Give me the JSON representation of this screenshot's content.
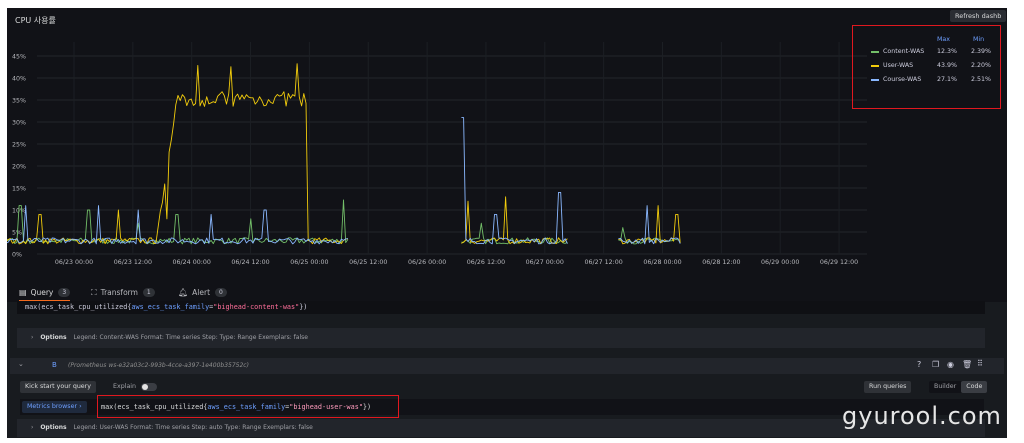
{
  "panel": {
    "title": "CPU 사용률",
    "refresh_label": "Refresh dashb"
  },
  "chart_data": {
    "type": "line",
    "title": "CPU 사용률",
    "ylim": [
      0,
      48
    ],
    "y_ticks": [
      "0%",
      "5%",
      "10%",
      "15%",
      "20%",
      "25%",
      "30%",
      "35%",
      "40%",
      "45%"
    ],
    "x_ticks": [
      "06/23 00:00",
      "06/23 12:00",
      "06/24 00:00",
      "06/24 12:00",
      "06/25 00:00",
      "06/25 12:00",
      "06/26 00:00",
      "06/26 12:00",
      "06/27 00:00",
      "06/27 12:00",
      "06/28 00:00",
      "06/28 12:00",
      "06/29 00:00",
      "06/29 12:00"
    ],
    "grid": true,
    "legend_placement": "top-right",
    "legend_columns": [
      "Max",
      "Min"
    ],
    "series": [
      {
        "name": "Content-WAS",
        "color": "#73bf69",
        "max": "12.3%",
        "min": "2.39%"
      },
      {
        "name": "User-WAS",
        "color": "#f2cc0c",
        "max": "43.9%",
        "min": "2.20%"
      },
      {
        "name": "Course-WAS",
        "color": "#8ab8ff",
        "max": "27.1%",
        "min": "2.51%"
      }
    ]
  },
  "tabs": [
    {
      "label": "Query",
      "count": "3",
      "icon": "database-icon",
      "active": true
    },
    {
      "label": "Transform",
      "count": "1",
      "icon": "transform-icon",
      "active": false
    },
    {
      "label": "Alert",
      "count": "0",
      "icon": "bell-icon",
      "active": false
    }
  ],
  "query_a": {
    "expr_fn": "max(ecs_task_cpu_utilized{",
    "expr_label": "aws_ecs_task_family",
    "expr_value": "\"bighead-content-was\"",
    "expr_end": "})",
    "options_label": "Options",
    "options_text": "Legend: Content-WAS   Format: Time series   Step:   Type: Range   Exemplars: false"
  },
  "query_b": {
    "ref": "B",
    "datasource": "(Prometheus ws-e32a03c2-993b-4cce-a397-1e400b35752c)",
    "kick_start": "Kick start your query",
    "explain": "Explain",
    "run_queries": "Run queries",
    "builder": "Builder",
    "code": "Code",
    "metrics_browser": "Metrics browser",
    "expr_fn": "max(ecs_task_cpu_utilized{",
    "expr_label": "aws_ecs_task_family",
    "expr_value": "\"bighead-user-was\"",
    "expr_end": "})",
    "options_label": "Options",
    "options_text": "Legend: User-WAS   Format: Time series   Step: auto   Type: Range   Exemplars: false"
  },
  "watermark": "gyurool.com"
}
